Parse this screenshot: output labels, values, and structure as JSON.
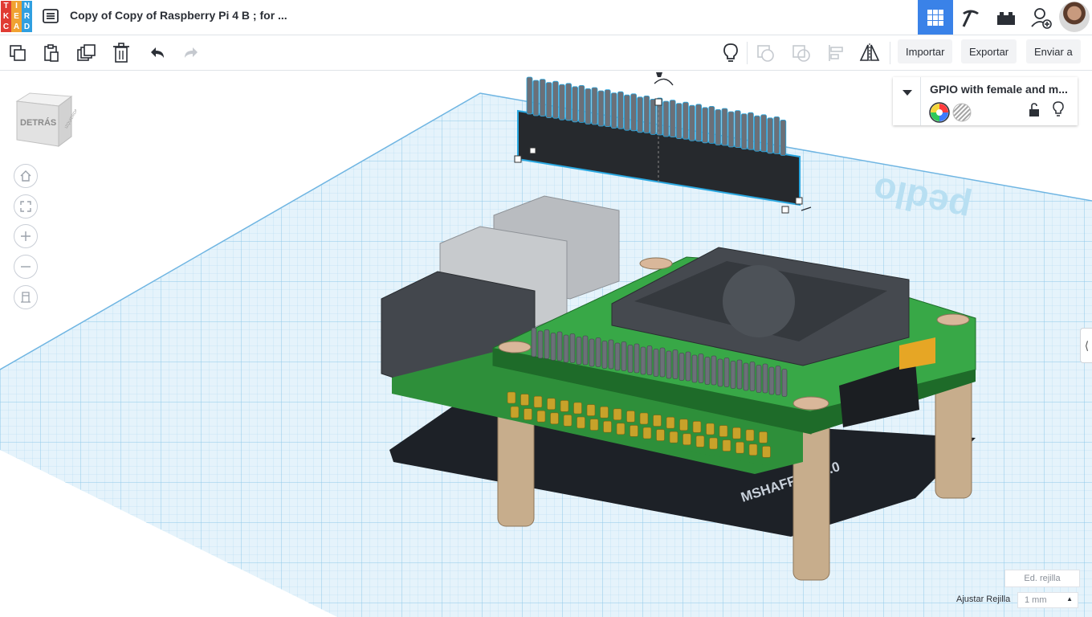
{
  "app": {
    "logo_letters": [
      "T",
      "I",
      "N",
      "K",
      "E",
      "R",
      "C",
      "A",
      "D"
    ],
    "logo_colors": [
      "#e03b33",
      "#f0a232",
      "#2f9fe0",
      "#e03b33",
      "#f0a232",
      "#2f9fe0",
      "#e03b33",
      "#f0a232",
      "#2f9fe0"
    ],
    "doc_title": "Copy of Copy of Raspberry Pi 4 B ; for ...",
    "accent": "#3a82e8"
  },
  "topbar": {
    "icons": [
      "grid-icon",
      "pickaxe-icon",
      "bricks-icon",
      "add-user-icon",
      "avatar"
    ],
    "active": "grid-icon"
  },
  "toolbar": {
    "tools": [
      "copy-icon",
      "paste-icon",
      "duplicate-icon",
      "delete-icon",
      "undo-icon",
      "redo-icon"
    ],
    "right_tools": [
      "light-bulb-icon",
      "group-icon",
      "ungroup-icon",
      "align-icon",
      "mirror-icon"
    ],
    "import_label": "Importar",
    "export_label": "Exportar",
    "send_label": "Enviar a"
  },
  "viewcube": {
    "face_label": "DETRÁS",
    "side_label": "IZQUIERDA"
  },
  "nav": [
    "home-icon",
    "fit-icon",
    "zoom-in-icon",
    "zoom-out-icon",
    "ortho-icon"
  ],
  "shape_panel": {
    "name": "GPIO with female and m...",
    "solid_color": "multicolor",
    "hole": "hole-pattern"
  },
  "workplane": {
    "watermark": "pedlo",
    "board_text": "MSHAFFIQ V1.0"
  },
  "grid": {
    "edit_label": "Ed. rejilla",
    "snap_label": "Ajustar Rejilla",
    "snap_value": "1 mm"
  }
}
